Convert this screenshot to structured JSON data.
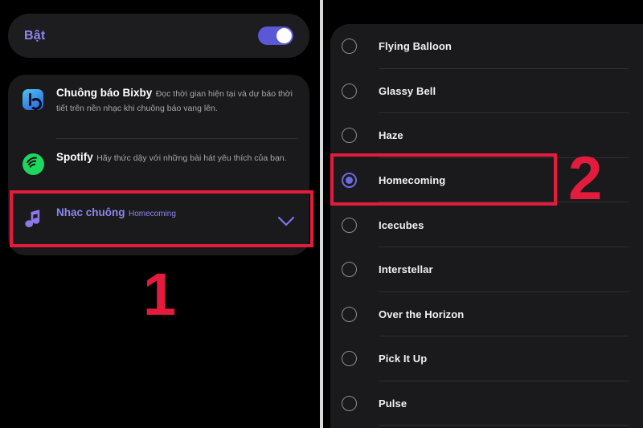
{
  "left_panel": {
    "toggle_card": {
      "label": "Bật",
      "toggle_state": "on",
      "accent_color": "#8b87f0",
      "switch_color": "#5a58d6"
    },
    "options": [
      {
        "icon": "bixby-icon",
        "title": "Chuông báo Bixby",
        "description": "Đọc thời gian hiện tại và dự báo thời tiết trên nền nhạc khi chuông báo vang lên.",
        "subtitle": "",
        "selected": false,
        "highlighted": false
      },
      {
        "icon": "spotify-icon",
        "title": "Spotify",
        "description": "Hãy thức dậy với những bài hát yêu thích của bạn.",
        "subtitle": "",
        "selected": false,
        "highlighted": false
      },
      {
        "icon": "music-note-icon",
        "title": "Nhạc chuông",
        "description": "",
        "subtitle": "Homecoming",
        "selected": true,
        "highlighted": true
      }
    ],
    "annotation": {
      "number": "1",
      "color": "#e31b3d"
    }
  },
  "right_panel": {
    "ringtones": [
      {
        "name": "Flying Balloon",
        "selected": false
      },
      {
        "name": "Glassy Bell",
        "selected": false
      },
      {
        "name": "Haze",
        "selected": false
      },
      {
        "name": "Homecoming",
        "selected": true
      },
      {
        "name": "Icecubes",
        "selected": false
      },
      {
        "name": "Interstellar",
        "selected": false
      },
      {
        "name": "Over the Horizon",
        "selected": false
      },
      {
        "name": "Pick It Up",
        "selected": false
      },
      {
        "name": "Pulse",
        "selected": false
      }
    ],
    "annotation": {
      "number": "2",
      "color": "#e31b3d"
    }
  },
  "colors": {
    "background": "#000000",
    "card": "#1a1a1c",
    "accent_purple": "#8b87f0",
    "radio_selected": "#6d6ae0",
    "annotation_red": "#e31b3d",
    "spotify_green": "#1ed760",
    "divider": "#d8d8d8"
  }
}
